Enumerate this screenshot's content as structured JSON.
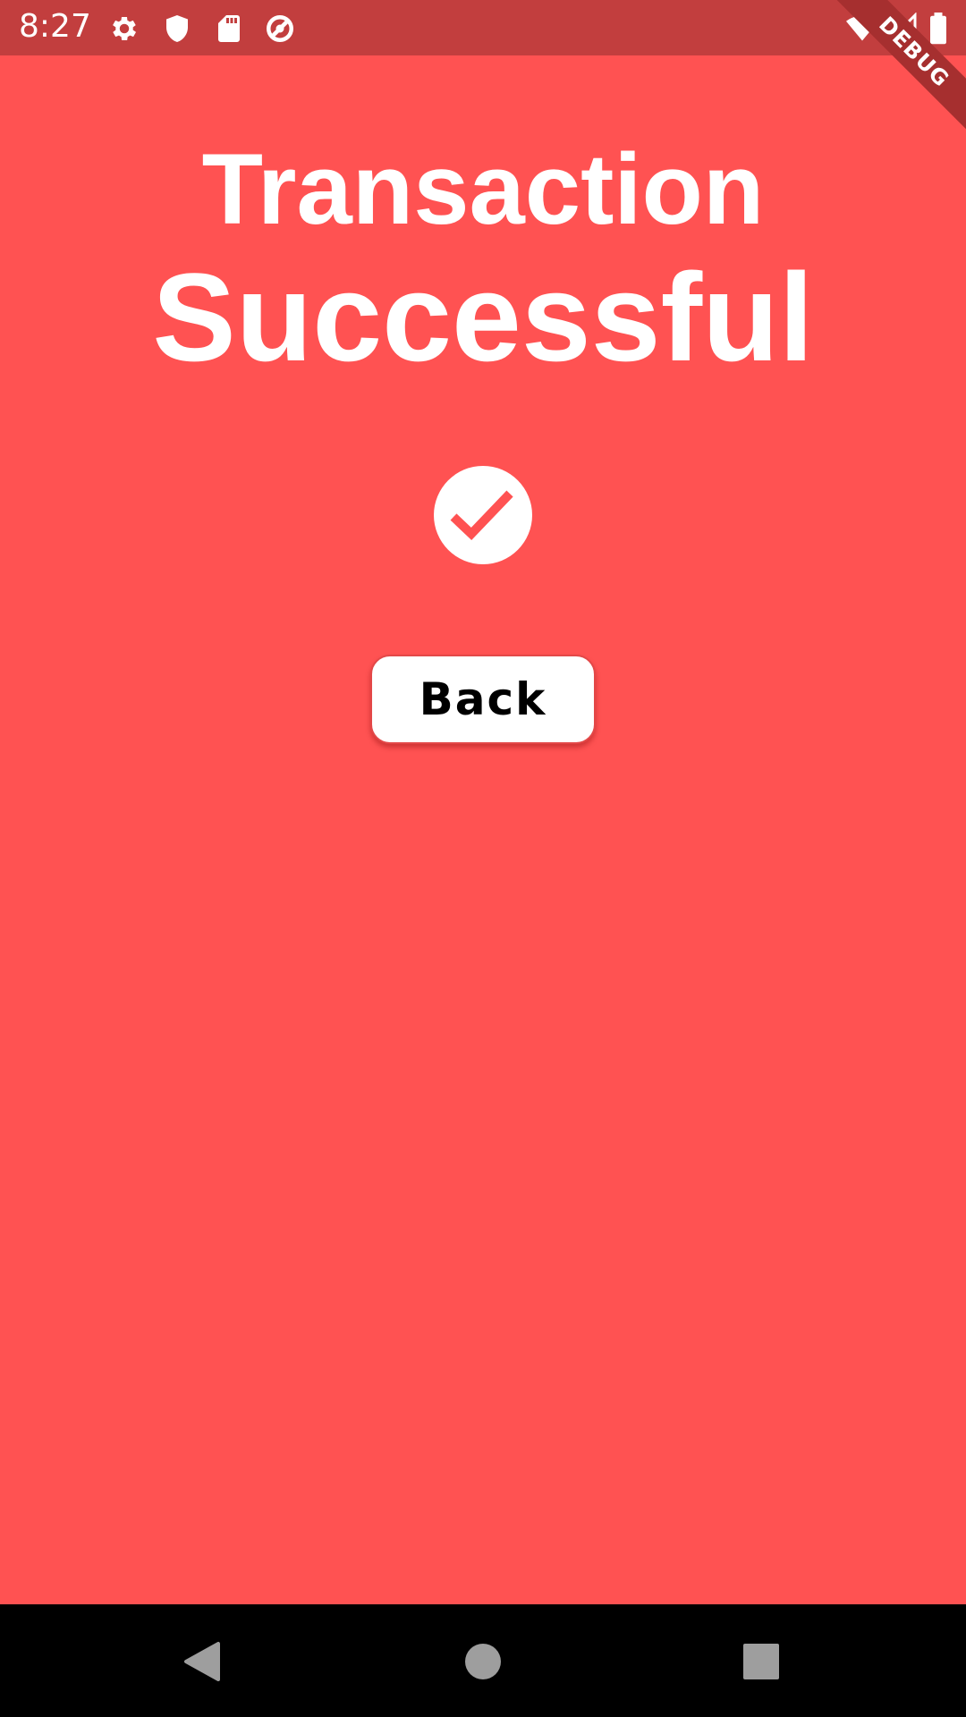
{
  "status_bar": {
    "time": "8:27",
    "icons": [
      "settings-icon",
      "shield-icon",
      "sd-card-icon",
      "data-saver-icon",
      "wifi-icon",
      "signal-icon",
      "battery-icon"
    ]
  },
  "debug_banner": {
    "label": "DEBUG"
  },
  "main": {
    "title_line1": "Transaction",
    "title_line2": "Successful",
    "status_icon": "check-circle-icon",
    "back_button": {
      "label": "Back"
    }
  },
  "nav_bar": {
    "buttons": [
      "back-triangle-icon",
      "home-circle-icon",
      "recents-square-icon"
    ]
  },
  "colors": {
    "background": "#FF5252",
    "status_bar": "#C23E3E",
    "text": "#FFFFFF",
    "button_text": "#000000",
    "nav_bar": "#000000"
  }
}
